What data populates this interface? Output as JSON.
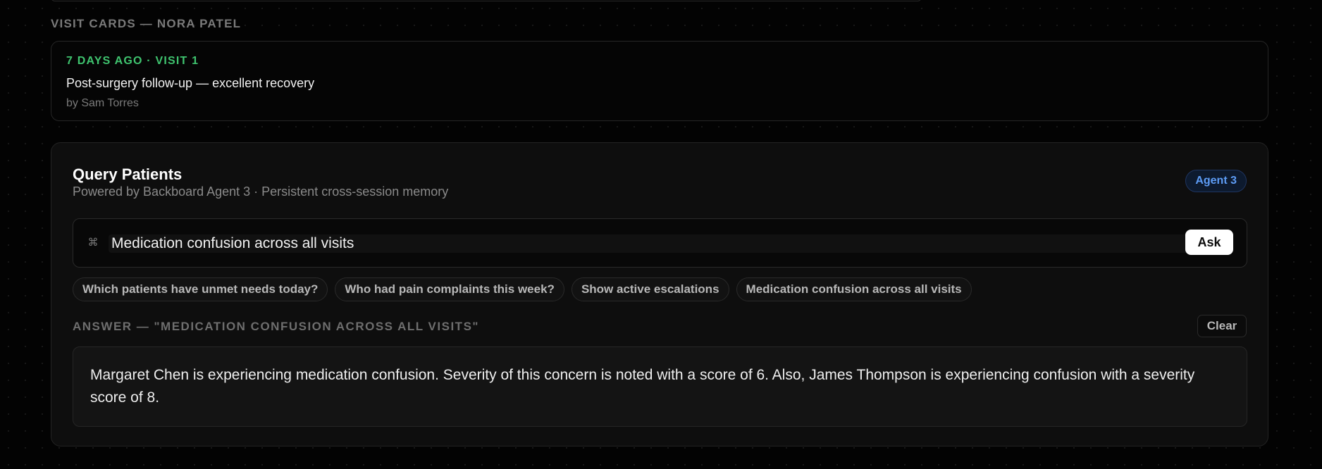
{
  "visit_cards": {
    "section_label": "VISIT CARDS — NORA PATEL",
    "cards": [
      {
        "meta": "7 DAYS AGO · VISIT 1",
        "title": "Post-surgery follow-up — excellent recovery",
        "author": "by Sam Torres"
      }
    ]
  },
  "query": {
    "title": "Query Patients",
    "subtitle": "Powered by Backboard Agent 3 · Persistent cross-session memory",
    "agent_badge": "Agent 3",
    "input_value": "Medication confusion across all visits",
    "ask_label": "Ask",
    "suggestions": [
      "Which patients have unmet needs today?",
      "Who had pain complaints this week?",
      "Show active escalations",
      "Medication confusion across all visits"
    ],
    "answer_label": "ANSWER — \"MEDICATION CONFUSION ACROSS ALL VISITS\"",
    "clear_label": "Clear",
    "answer_text": "Margaret Chen is experiencing medication confusion. Severity of this concern is noted with a score of 6. Also, James Thompson is experiencing confusion with a severity score of 8."
  },
  "colors": {
    "background": "#030303",
    "accent_green": "#3fc46f",
    "accent_blue": "#5d9cf5",
    "button_bg": "#ffffff"
  },
  "icons": {
    "input_icon": "command-icon"
  }
}
